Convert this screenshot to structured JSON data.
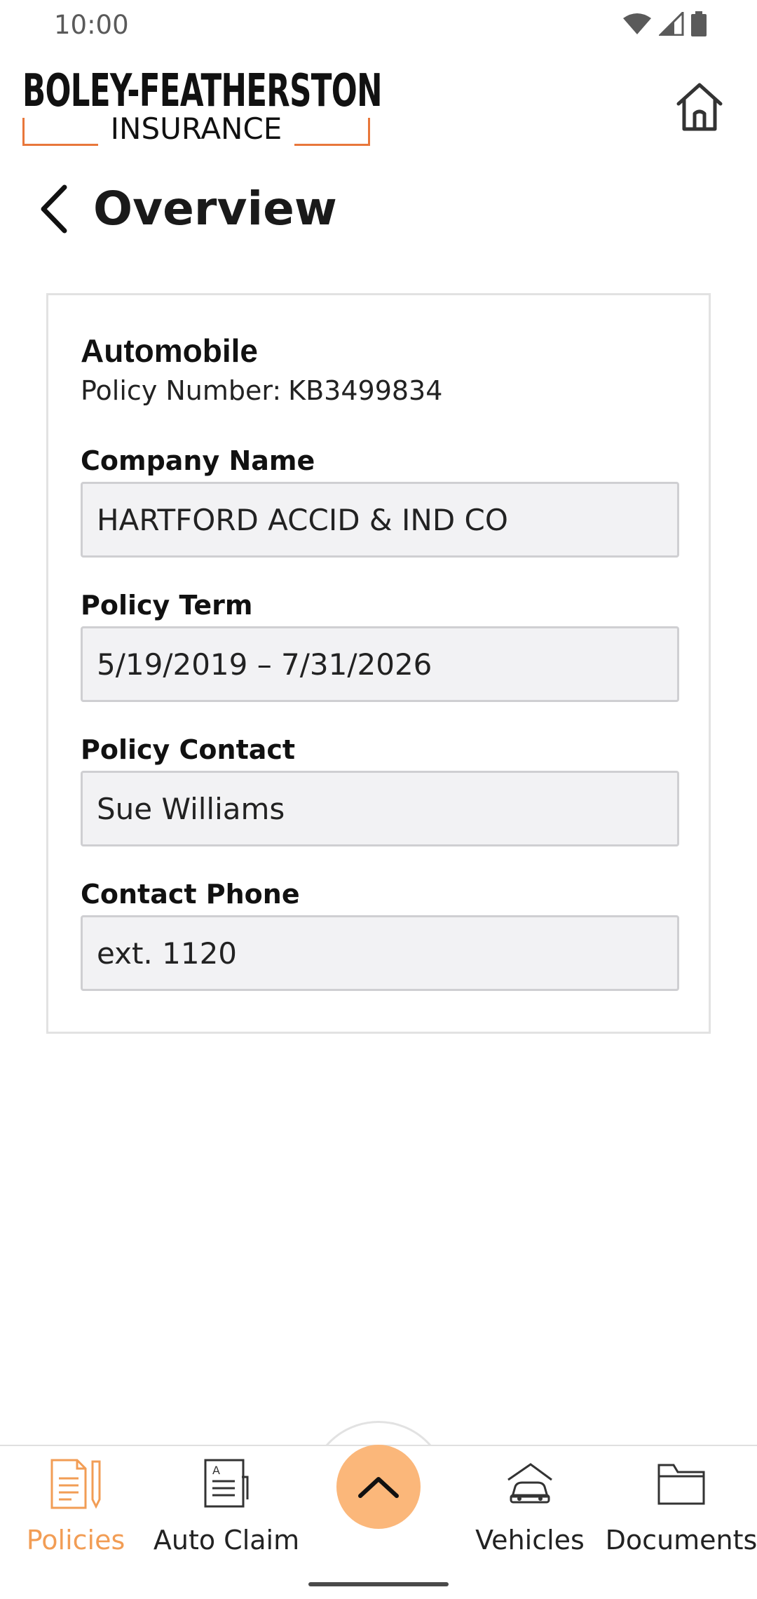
{
  "status_bar": {
    "time": "10:00",
    "icons": [
      "wifi-icon",
      "signal-icon",
      "battery-icon"
    ]
  },
  "header": {
    "logo_top": "BOLEY-FEATHERSTON",
    "logo_bottom": "INSURANCE",
    "home_icon": "home-icon"
  },
  "page": {
    "title": "Overview"
  },
  "policy": {
    "title": "Automobile",
    "number_label": "Policy Number:",
    "number_value": "KB3499834",
    "fields": [
      {
        "label": "Company Name",
        "value": "HARTFORD ACCID & IND CO"
      },
      {
        "label": "Policy Term",
        "value": "5/19/2019 – 7/31/2026"
      },
      {
        "label": "Policy Contact",
        "value": "Sue Williams"
      },
      {
        "label": "Contact Phone",
        "value": "ext. 1120"
      }
    ]
  },
  "bottom_nav": {
    "items": [
      {
        "label": "Policies",
        "icon": "policies-icon",
        "active": true
      },
      {
        "label": "Auto Claim",
        "icon": "auto-claim-icon",
        "active": false
      },
      {
        "label": "Vehicles",
        "icon": "vehicles-icon",
        "active": false
      },
      {
        "label": "Documents",
        "icon": "documents-icon",
        "active": false
      }
    ],
    "fab_icon": "chevron-up-icon"
  },
  "colors": {
    "accent": "#f29d55",
    "fab": "#fbb77a",
    "logo_frame": "#e8773b",
    "field_bg": "#f2f2f4"
  }
}
